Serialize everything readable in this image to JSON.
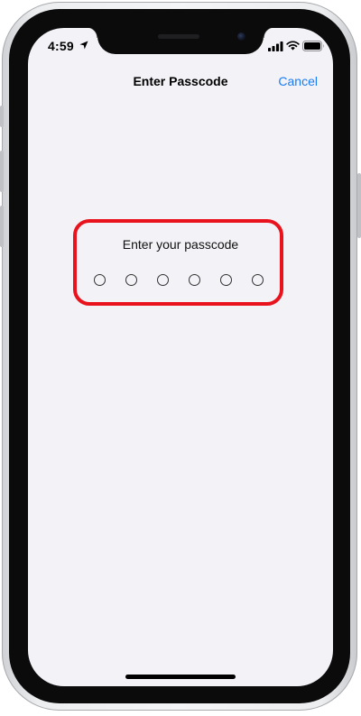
{
  "status_bar": {
    "time": "4:59",
    "icons": [
      "location-arrow-icon",
      "cellular-signal-icon",
      "wifi-icon",
      "battery-icon"
    ]
  },
  "nav": {
    "title": "Enter Passcode",
    "cancel_label": "Cancel"
  },
  "passcode": {
    "prompt": "Enter your passcode",
    "digit_count": 6,
    "digits_entered": 0
  },
  "colors": {
    "accent": "#1a7cf5",
    "highlight": "#e8131c",
    "screen_background": "#f2f2f7"
  }
}
